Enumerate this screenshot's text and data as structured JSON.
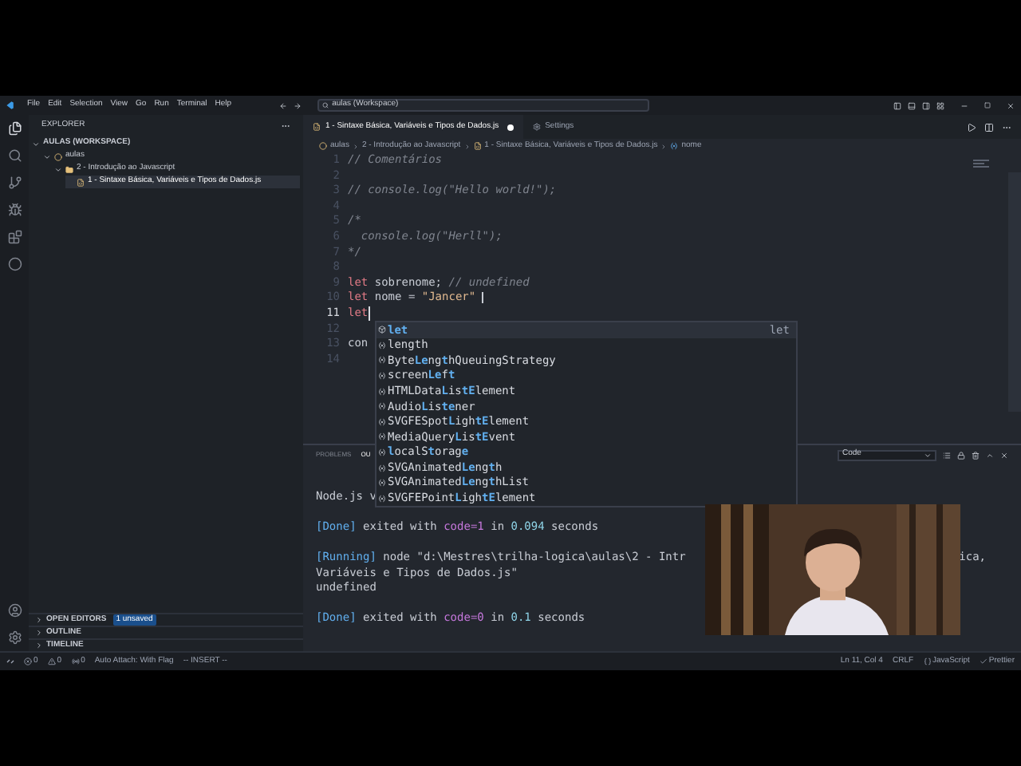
{
  "titlebar": {
    "menus": [
      "File",
      "Edit",
      "Selection",
      "View",
      "Go",
      "Run",
      "Terminal",
      "Help"
    ],
    "search": "aulas (Workspace)"
  },
  "sidebar": {
    "title": "EXPLORER",
    "tree": [
      {
        "label": "AULAS (WORKSPACE)",
        "kind": "root",
        "expanded": true,
        "children": [
          {
            "label": "aulas",
            "kind": "workspace",
            "expanded": true,
            "children": [
              {
                "label": "2 - Introdução ao Javascript",
                "kind": "folder",
                "expanded": true,
                "children": [
                  {
                    "label": "1 - Sintaxe Básica, Variáveis e Tipos de Dados.js",
                    "kind": "file",
                    "selected": true
                  }
                ]
              }
            ]
          }
        ]
      }
    ],
    "sections": [
      {
        "label": "OPEN EDITORS",
        "expanded": false,
        "badge": "1 unsaved"
      },
      {
        "label": "OUTLINE",
        "expanded": false
      },
      {
        "label": "TIMELINE",
        "expanded": false
      }
    ]
  },
  "tabs": [
    {
      "label": "1 - Sintaxe Básica, Variáveis e Tipos de Dados.js",
      "kind": "file",
      "selected": true,
      "dirty": true
    },
    {
      "label": "Settings",
      "kind": "settings",
      "selected": false,
      "dirty": false
    }
  ],
  "breadcrumbs": [
    {
      "label": "aulas",
      "kind": "workspace"
    },
    {
      "label": "2 - Introdução ao Javascript",
      "kind": "folder"
    },
    {
      "label": "1 - Sintaxe Básica, Variáveis e Tipos de Dados.js",
      "kind": "file"
    },
    {
      "label": "nome",
      "kind": "variable"
    }
  ],
  "editor": {
    "lines": [
      {
        "number": "1",
        "current": false,
        "tokens": [
          {
            "text": "// Comentários",
            "kind": "comment"
          }
        ]
      },
      {
        "number": "2",
        "current": false
      },
      {
        "number": "3",
        "current": false,
        "tokens": [
          {
            "text": "// console.log(\"Hello world!\");",
            "kind": "comment"
          }
        ]
      },
      {
        "number": "4",
        "current": false
      },
      {
        "number": "5",
        "current": false,
        "tokens": [
          {
            "text": "/*",
            "kind": "comment"
          }
        ]
      },
      {
        "number": "6",
        "current": false,
        "tokens": [
          {
            "text": "  console.log(\"Herll\");",
            "kind": "comment"
          }
        ]
      },
      {
        "number": "7",
        "current": false,
        "tokens": [
          {
            "text": "*/",
            "kind": "comment"
          }
        ]
      },
      {
        "number": "8",
        "current": false
      },
      {
        "number": "9",
        "current": false,
        "tokens": [
          {
            "text": "let",
            "kind": "keyword"
          },
          {
            "text": " sobrenome; ",
            "kind": "plain"
          },
          {
            "text": "// undefined",
            "kind": "comment"
          }
        ]
      },
      {
        "number": "10",
        "current": false,
        "tokens": [
          {
            "text": "let",
            "kind": "keyword"
          },
          {
            "text": " nome = ",
            "kind": "plain"
          },
          {
            "text": "\"Jancer\"",
            "kind": "string"
          }
        ]
      },
      {
        "number": "11",
        "current": true,
        "tokens": [
          {
            "text": "let",
            "kind": "keyword"
          }
        ]
      },
      {
        "number": "12",
        "current": false
      },
      {
        "number": "13",
        "current": false,
        "tokens": [
          {
            "text": "con",
            "kind": "plain"
          }
        ]
      },
      {
        "number": "14",
        "current": false
      }
    ]
  },
  "suggestions": [
    {
      "kind": "keyword",
      "selected": true,
      "detail": "let",
      "parts": [
        {
          "text": "let",
          "match": true
        }
      ]
    },
    {
      "kind": "variable",
      "selected": false,
      "parts": [
        {
          "text": "length",
          "match": false
        }
      ]
    },
    {
      "kind": "variable",
      "selected": false,
      "parts": [
        {
          "text": "Byte",
          "match": false
        },
        {
          "text": "Le",
          "match": true
        },
        {
          "text": "ng",
          "match": false
        },
        {
          "text": "t",
          "match": true
        },
        {
          "text": "hQueuingStrategy",
          "match": false
        }
      ]
    },
    {
      "kind": "variable",
      "selected": false,
      "parts": [
        {
          "text": "screen",
          "match": false
        },
        {
          "text": "Le",
          "match": true
        },
        {
          "text": "f",
          "match": false
        },
        {
          "text": "t",
          "match": true
        }
      ]
    },
    {
      "kind": "variable",
      "selected": false,
      "parts": [
        {
          "text": "HTMLData",
          "match": false
        },
        {
          "text": "L",
          "match": true
        },
        {
          "text": "is",
          "match": false
        },
        {
          "text": "tE",
          "match": true
        },
        {
          "text": "lement",
          "match": false
        }
      ]
    },
    {
      "kind": "variable",
      "selected": false,
      "parts": [
        {
          "text": "Audio",
          "match": false
        },
        {
          "text": "L",
          "match": true
        },
        {
          "text": "is",
          "match": false
        },
        {
          "text": "te",
          "match": true
        },
        {
          "text": "ner",
          "match": false
        }
      ]
    },
    {
      "kind": "variable",
      "selected": false,
      "parts": [
        {
          "text": "SVGFESpot",
          "match": false
        },
        {
          "text": "L",
          "match": true
        },
        {
          "text": "igh",
          "match": false
        },
        {
          "text": "tE",
          "match": true
        },
        {
          "text": "lement",
          "match": false
        }
      ]
    },
    {
      "kind": "variable",
      "selected": false,
      "parts": [
        {
          "text": "MediaQuery",
          "match": false
        },
        {
          "text": "L",
          "match": true
        },
        {
          "text": "is",
          "match": false
        },
        {
          "text": "tE",
          "match": true
        },
        {
          "text": "vent",
          "match": false
        }
      ]
    },
    {
      "kind": "variable",
      "selected": false,
      "parts": [
        {
          "text": "l",
          "match": true
        },
        {
          "text": "ocalS",
          "match": false
        },
        {
          "text": "t",
          "match": true
        },
        {
          "text": "orag",
          "match": false
        },
        {
          "text": "e",
          "match": true
        }
      ]
    },
    {
      "kind": "variable",
      "selected": false,
      "parts": [
        {
          "text": "SVGAnimated",
          "match": false
        },
        {
          "text": "Le",
          "match": true
        },
        {
          "text": "ng",
          "match": false
        },
        {
          "text": "t",
          "match": true
        },
        {
          "text": "h",
          "match": false
        }
      ]
    },
    {
      "kind": "variable",
      "selected": false,
      "parts": [
        {
          "text": "SVGAnimated",
          "match": false
        },
        {
          "text": "Le",
          "match": true
        },
        {
          "text": "ng",
          "match": false
        },
        {
          "text": "t",
          "match": true
        },
        {
          "text": "hList",
          "match": false
        }
      ]
    },
    {
      "kind": "variable",
      "selected": false,
      "parts": [
        {
          "text": "SVGFEPoint",
          "match": false
        },
        {
          "text": "L",
          "match": true
        },
        {
          "text": "igh",
          "match": false
        },
        {
          "text": "tE",
          "match": true
        },
        {
          "text": "lement",
          "match": false
        }
      ]
    }
  ],
  "panel": {
    "tabs": [
      {
        "label": "PROBLEMS",
        "selected": false
      },
      {
        "label": "OU",
        "selected": true
      }
    ],
    "dropdown": "Code",
    "lines": [
      {
        "tokens": [
          {
            "text": "Node.js v",
            "kind": "plain"
          }
        ]
      },
      {
        "gap_before": true,
        "tokens": [
          {
            "text": "[Done]",
            "kind": "tag"
          },
          {
            "text": " exited with ",
            "kind": "plain"
          },
          {
            "text": "code=1",
            "kind": "key"
          },
          {
            "text": " in ",
            "kind": "plain"
          },
          {
            "text": "0.094",
            "kind": "number"
          },
          {
            "text": " seconds",
            "kind": "plain"
          }
        ]
      },
      {
        "gap_before": true,
        "tokens": [
          {
            "text": "[Running]",
            "kind": "tag"
          },
          {
            "text": " node \"d:\\Mestres\\trilha-logica\\aulas\\2 - Intr",
            "kind": "plain"
          }
        ],
        "tail": "ica,"
      },
      {
        "tokens": [
          {
            "text": "Variáveis e Tipos de Dados.js\"",
            "kind": "plain"
          }
        ]
      },
      {
        "tokens": [
          {
            "text": "undefined",
            "kind": "plain"
          }
        ]
      },
      {
        "gap_before": true,
        "tokens": [
          {
            "text": "[Done]",
            "kind": "tag"
          },
          {
            "text": " exited with ",
            "kind": "plain"
          },
          {
            "text": "code=0",
            "kind": "key"
          },
          {
            "text": " in ",
            "kind": "plain"
          },
          {
            "text": "0.1",
            "kind": "number"
          },
          {
            "text": " seconds",
            "kind": "plain"
          }
        ]
      }
    ]
  },
  "status_bar": {
    "left": [
      {
        "kind": "errors",
        "text": "0"
      },
      {
        "kind": "warnings",
        "text": "0"
      },
      {
        "kind": "ports",
        "text": "0"
      },
      {
        "kind": "plain",
        "text": "Auto Attach: With Flag"
      },
      {
        "kind": "plain",
        "text": "-- INSERT --"
      }
    ],
    "right": [
      {
        "kind": "plain",
        "text": "Ln 11, Col 4"
      },
      {
        "kind": "plain",
        "text": "CRLF"
      },
      {
        "kind": "language",
        "text": "JavaScript"
      },
      {
        "kind": "check",
        "text": "Prettier"
      }
    ]
  }
}
